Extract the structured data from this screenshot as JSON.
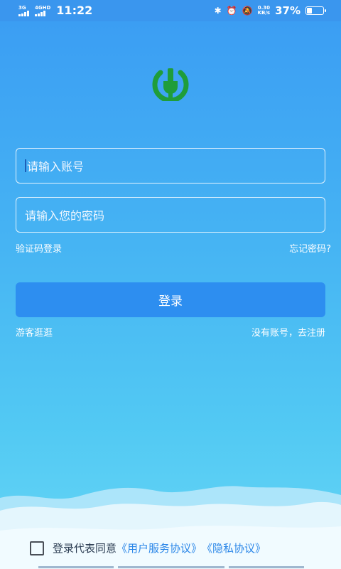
{
  "status_bar": {
    "network_1": "3G",
    "network_2": "4GHD",
    "time": "11:22",
    "speed_value": "0.30",
    "speed_unit": "KB/s",
    "battery_percent": "37%",
    "battery_level": 0.37,
    "icons": [
      "bluetooth-icon",
      "alarm-icon",
      "mute-icon"
    ]
  },
  "logo": {
    "icon": "power-plug-icon",
    "color": "#1f9d3a"
  },
  "form": {
    "account_placeholder": "请输入账号",
    "password_placeholder": "请输入您的密码",
    "sms_login": "验证码登录",
    "forgot_password": "忘记密码?",
    "login_button": "登录",
    "guest": "游客逛逛",
    "register": "没有账号，去注册"
  },
  "agreement": {
    "prefix": "登录代表同意",
    "user_agreement": "《用户服务协议》",
    "privacy": "《隐私协议》",
    "checked": false
  },
  "colors": {
    "accent": "#2d8ef0",
    "link": "#2a86e8",
    "logo_green": "#1f9d3a"
  }
}
